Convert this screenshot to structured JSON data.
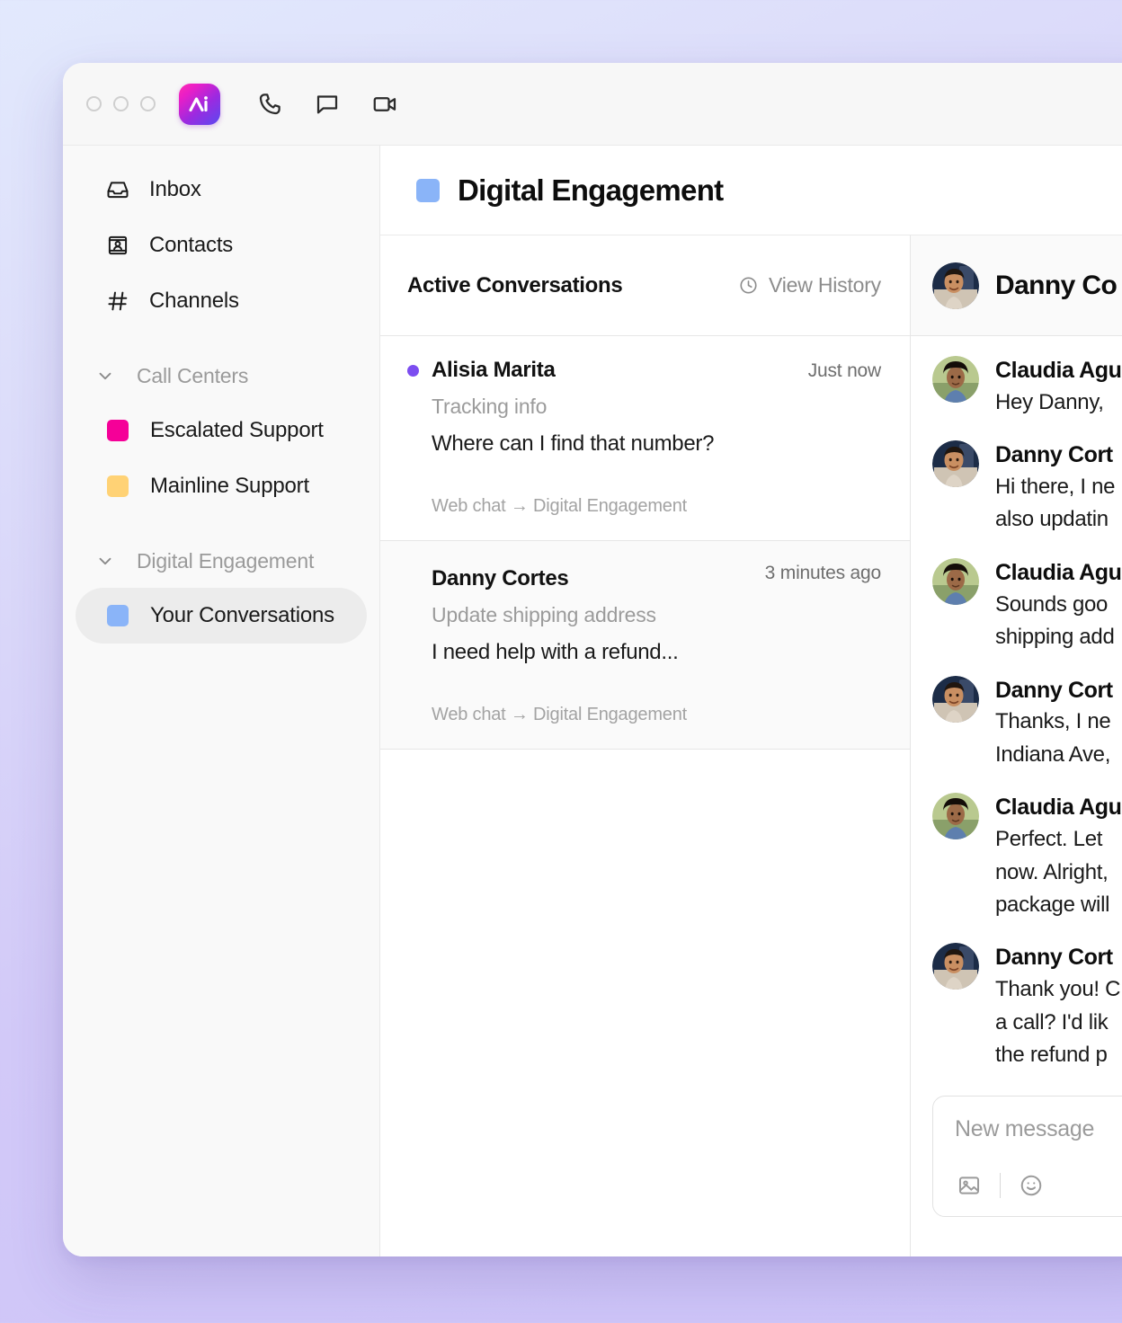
{
  "titlebar": {
    "window_controls": [
      "close",
      "minimize",
      "maximize"
    ],
    "logo_name": "app-logo",
    "logo_text": "Ai",
    "icons": [
      {
        "name": "phone-icon",
        "label": "Call"
      },
      {
        "name": "chat-icon",
        "label": "Chat"
      },
      {
        "name": "video-icon",
        "label": "Video"
      }
    ]
  },
  "sidebar": {
    "nav": [
      {
        "label": "Inbox",
        "icon": "inbox-icon",
        "name": "sidebar-item-inbox"
      },
      {
        "label": "Contacts",
        "icon": "contacts-icon",
        "name": "sidebar-item-contacts"
      },
      {
        "label": "Channels",
        "icon": "hash-icon",
        "name": "sidebar-item-channels"
      }
    ],
    "groups": [
      {
        "label": "Call Centers",
        "name": "sidebar-group-call-centers",
        "expanded": true,
        "items": [
          {
            "label": "Escalated Support",
            "color": "#f50098",
            "name": "sidebar-item-escalated-support",
            "selected": false
          },
          {
            "label": "Mainline Support",
            "color": "#ffd275",
            "name": "sidebar-item-mainline-support",
            "selected": false
          }
        ]
      },
      {
        "label": "Digital Engagement",
        "name": "sidebar-group-digital-engagement",
        "expanded": true,
        "items": [
          {
            "label": "Your Conversations",
            "color": "#8ab4f8",
            "name": "sidebar-item-your-conversations",
            "selected": true
          }
        ]
      }
    ]
  },
  "page_header": {
    "title": "Digital Engagement",
    "swatch_color": "#8ab4f8"
  },
  "conversation_list": {
    "title": "Active Conversations",
    "view_history_label": "View History",
    "items": [
      {
        "name": "Alisia Marita",
        "subject": "Tracking info",
        "preview": "Where can I find that number?",
        "time": "Just now",
        "meta": "Web chat → Digital Engagement",
        "unread": true,
        "selected": false
      },
      {
        "name": "Danny Cortes",
        "subject": "Update shipping address",
        "preview": "I need help with a refund...",
        "time": "3 minutes ago",
        "meta": "Web chat → Digital Engagement",
        "unread": false,
        "selected": true
      }
    ]
  },
  "chat": {
    "header_name": "Danny Co",
    "messages": [
      {
        "author": "Claudia Agu",
        "lines": [
          "Hey Danny,"
        ],
        "avatar": "claudia"
      },
      {
        "author": "Danny Cort",
        "lines": [
          "Hi there, I ne",
          "also updatin"
        ],
        "avatar": "danny"
      },
      {
        "author": "Claudia Agu",
        "lines": [
          "Sounds goo",
          "shipping add"
        ],
        "avatar": "claudia"
      },
      {
        "author": "Danny Cort",
        "lines": [
          "Thanks, I ne",
          "Indiana Ave,"
        ],
        "avatar": "danny"
      },
      {
        "author": "Claudia Agu",
        "lines": [
          "Perfect. Let",
          "now. Alright,",
          "package will"
        ],
        "avatar": "claudia"
      },
      {
        "author": "Danny Cort",
        "lines": [
          "Thank you! C",
          "a call? I'd lik",
          "the refund p"
        ],
        "avatar": "danny"
      }
    ],
    "composer": {
      "placeholder": "New message",
      "tools": [
        {
          "name": "image-icon"
        },
        {
          "name": "emoji-icon"
        }
      ]
    }
  },
  "colors": {
    "accent_purple": "#7c4df0",
    "brand_blue": "#8ab4f8",
    "escalated_pink": "#f50098",
    "mainline_yellow": "#ffd275",
    "background_top": "#e2e9fd",
    "background_bottom": "#cdc4f8"
  }
}
